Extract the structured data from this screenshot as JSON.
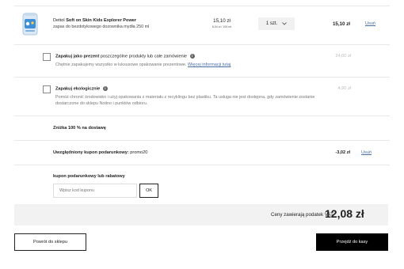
{
  "product": {
    "icon": "soap-bottle-icon",
    "brand": "Dettol",
    "name_bold": "Soft on Skin Kids Explorer Power",
    "subtitle": "zapas do bezdotykowego dozownika mydła 250 ml",
    "unit_price": "15,10 zł",
    "unit_per": "6,04 zł / 100 ml",
    "quantity": "1 szt.",
    "total": "15,10 zł",
    "remove_label": "Usuń"
  },
  "gift_wrap": {
    "title": "Zapakuj jako prezent",
    "title_rest": "poszczególne produkty lub całe zamówienie",
    "description": "Chętnie zapakujemy wszystko w luksusowe opakowanie prezentowe.",
    "more_link": "Więcej informacji tutaj",
    "price": "24,00 zł"
  },
  "eco_wrap": {
    "title": "Zapakuj ekologicznie",
    "description": "Pomóż chronić środowisko i użyj opakowania z materiału z recyklingu bez plastiku. Ta usługa nie jest dostępna, gdy zamówienie zostanie dostarczone do sklepu Notino i punktów odbioru.",
    "price": "4,90 zł"
  },
  "shipping_discount": "Zniżka 100 % na dostawę",
  "coupon_applied": {
    "label": "Uwzględniony kupon podarunkowy:",
    "code": "promo20",
    "amount": "-3,02 zł",
    "remove_label": "Usuń"
  },
  "coupon_entry": {
    "heading": "kupon podarunkowy lub rabatowy",
    "placeholder": "Wpisz kod kuponu",
    "ok_label": "OK"
  },
  "summary": {
    "vat_label": "Ceny zawierają podatek VAT",
    "total": "12,08 zł"
  },
  "buttons": {
    "back": "Powrót do sklepu",
    "checkout": "Przejdź do kasy"
  },
  "colors": {
    "accent_link": "#4a6fa5",
    "checkout_bg": "#000000",
    "summary_bg": "#f2f2f2"
  }
}
